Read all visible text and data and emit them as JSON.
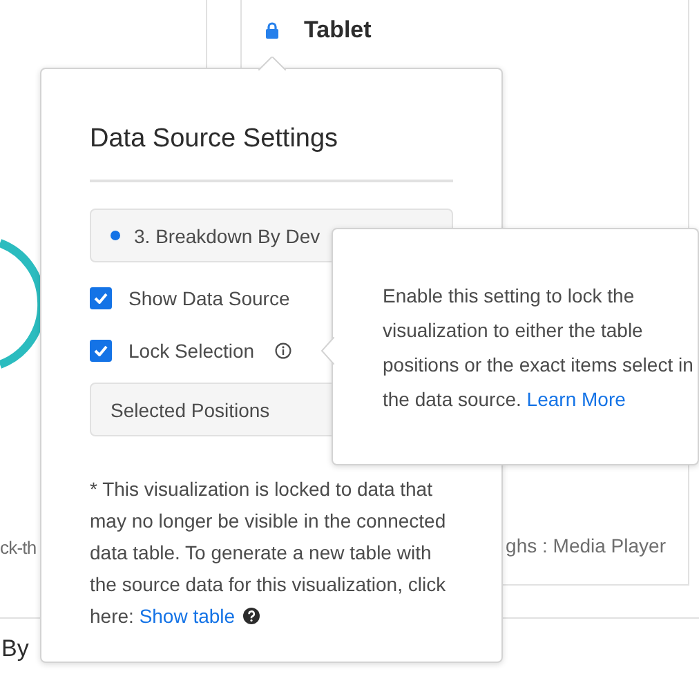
{
  "background": {
    "card_title": "Tablet",
    "left_caption": "ck-th",
    "right_caption": "ghs : Media Player",
    "section_title": "By"
  },
  "popover": {
    "title": "Data Source Settings",
    "source": {
      "label": "3. Breakdown By Dev",
      "color": "#1473e6"
    },
    "options": [
      {
        "label": "Show Data Source",
        "checked": true
      },
      {
        "label": "Lock Selection",
        "checked": true,
        "info": true
      }
    ],
    "lock_mode": {
      "value": "Selected Positions"
    },
    "note": {
      "text": "* This visualization is locked to data that may no longer be visible in the connected data table. To generate a new table with the source data for this visualization, click here:",
      "link": "Show table"
    }
  },
  "tooltip": {
    "text": "Enable this setting to lock the visualization to either the table positions or the exact items select in the data source.",
    "link": "Learn More"
  }
}
